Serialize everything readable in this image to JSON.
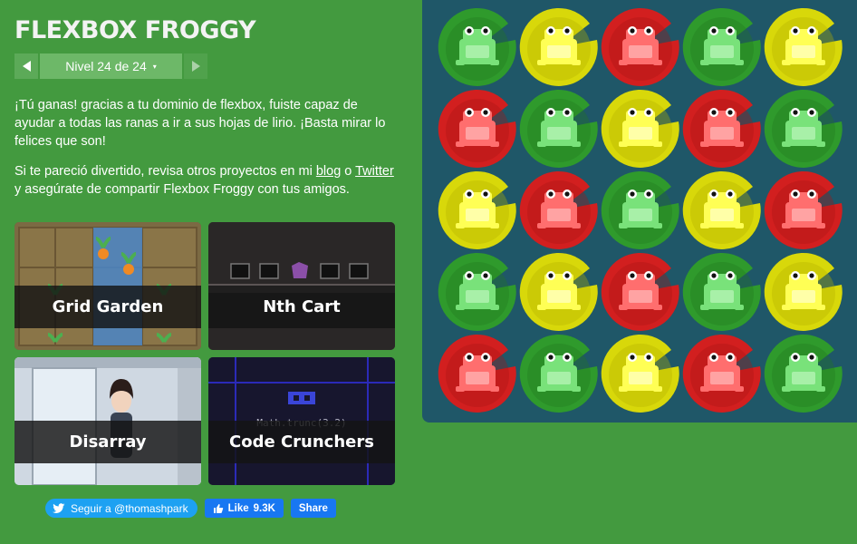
{
  "app": {
    "title": "FLEXBOX FROGGY"
  },
  "level_nav": {
    "indicator": "Nivel 24 de 24",
    "caret": "▾"
  },
  "win_text": "¡Tú ganas! gracias a tu dominio de flexbox, fuiste capaz de ayudar a todas las ranas a ir a sus hojas de lirio. ¡Basta mirar lo felices que son!",
  "more_text": {
    "part1": "Si te pareció divertido, revisa otros proyectos en mi ",
    "link_blog": "blog",
    "part2": " o ",
    "link_twitter": "Twitter",
    "part3": " y asegúrate de compartir Flexbox Froggy con tus amigos."
  },
  "projects": [
    {
      "name": "Grid Garden"
    },
    {
      "name": "Nth Cart"
    },
    {
      "name": "Disarray"
    },
    {
      "name": "Code Crunchers",
      "code_text": "Math.trunc(3.2)"
    }
  ],
  "social": {
    "twitter_label": "Seguir a @thomashpark",
    "fb_like_label": "Like",
    "fb_like_count": "9.3K",
    "fb_share_label": "Share"
  },
  "board": {
    "rows": [
      [
        "green",
        "yellow",
        "red",
        "green",
        "yellow"
      ],
      [
        "red",
        "green",
        "yellow",
        "red",
        "green"
      ],
      [
        "yellow",
        "red",
        "green",
        "yellow",
        "red"
      ],
      [
        "green",
        "yellow",
        "red",
        "green",
        "yellow"
      ],
      [
        "red",
        "green",
        "yellow",
        "red",
        "green"
      ]
    ]
  },
  "colors": {
    "background": "#439a3f",
    "board": "#1f5768",
    "green": "#2f9a2c",
    "yellow": "#d8d80a",
    "red": "#d21f1f"
  }
}
